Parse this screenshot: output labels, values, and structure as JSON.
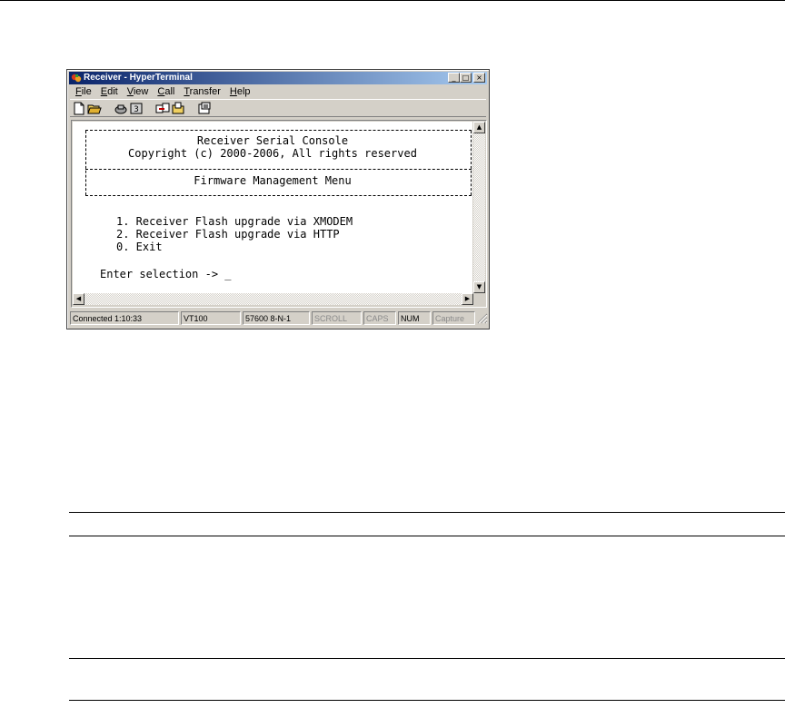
{
  "window": {
    "title": "Receiver - HyperTerminal",
    "controls": {
      "minimize": "_",
      "maximize": "□",
      "close": "×"
    }
  },
  "menu": [
    {
      "label": "File",
      "accel": "F"
    },
    {
      "label": "Edit",
      "accel": "E"
    },
    {
      "label": "View",
      "accel": "V"
    },
    {
      "label": "Call",
      "accel": "C"
    },
    {
      "label": "Transfer",
      "accel": "T"
    },
    {
      "label": "Help",
      "accel": "H"
    }
  ],
  "toolbar": {
    "icons": [
      "new-icon",
      "open-icon",
      "disconnect-icon",
      "properties-dial-icon",
      "send-icon",
      "receive-icon",
      "properties-icon"
    ]
  },
  "terminal": {
    "header_title": "Receiver Serial Console",
    "copyright": "Copyright (c) 2000-2006, All rights reserved",
    "menu_title": "Firmware Management Menu",
    "options": [
      "1. Receiver Flash upgrade via XMODEM",
      "2. Receiver Flash upgrade via HTTP",
      "0. Exit"
    ],
    "prompt": "Enter selection -> ",
    "cursor": "_"
  },
  "statusbar": {
    "connected": "Connected 1:10:33",
    "emulation": "VT100",
    "port_settings": "57600 8-N-1",
    "scroll": "SCROLL",
    "caps": "CAPS",
    "num": "NUM",
    "capture": "Capture",
    "colors": {
      "inactive": "#8a8a8a"
    }
  },
  "colors": {
    "titlebar_start": "#0a246a",
    "titlebar_end": "#a6caf0",
    "chrome": "#d4d0c8"
  }
}
